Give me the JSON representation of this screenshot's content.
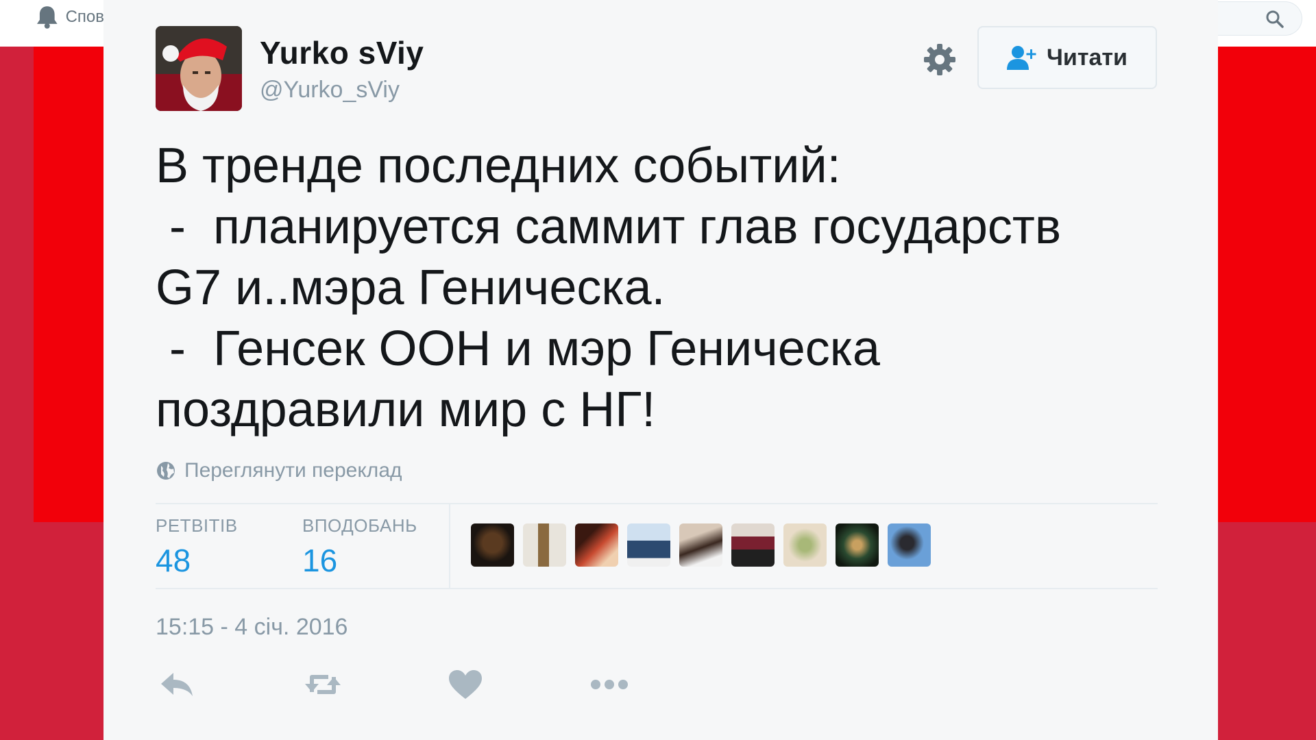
{
  "background": {
    "notifications_label": "Спов"
  },
  "tweet": {
    "display_name": "Yurko sViy",
    "screen_name": "@Yurko_sViy",
    "follow_label": "Читати",
    "text": "В тренде последних событий:\n -  планируется саммит глав государств\nG7 и..мэра Геническа.\n -  Генсек ООН и мэр Геническа\nпоздравили мир с НГ!",
    "translate_label": "Переглянути переклад",
    "stats": {
      "retweets_label": "РЕТВІТІВ",
      "retweets_value": "48",
      "likes_label": "ВПОДОБАНЬ",
      "likes_value": "16"
    },
    "timestamp": "15:15 - 4 січ. 2016"
  },
  "colors": {
    "accent": "#1b95e0",
    "muted": "#8899a6",
    "background_red": "#f2000a",
    "background_red_dark": "#d1213b"
  },
  "icons": {
    "notifications": "bell-icon",
    "search": "search-icon",
    "settings": "gear-icon",
    "follow": "add-user-icon",
    "translate": "globe-icon",
    "reply": "reply-icon",
    "retweet": "retweet-icon",
    "like": "heart-icon",
    "more": "more-icon"
  }
}
